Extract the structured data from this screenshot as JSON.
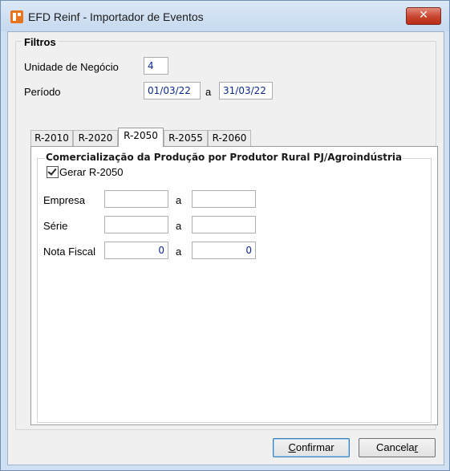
{
  "window": {
    "title": "EFD Reinf - Importador de Eventos",
    "close_label": "✕",
    "app_icon": "reinf-app-icon"
  },
  "filtros": {
    "legend": "Filtros",
    "unidade_label": "Unidade de Negócio",
    "unidade_value": "4",
    "periodo_label": "Período",
    "periodo_start": "01/03/22",
    "periodo_sep": "a",
    "periodo_end": "31/03/22"
  },
  "tabs": [
    {
      "label": "R-2010",
      "active": false
    },
    {
      "label": "R-2020",
      "active": false
    },
    {
      "label": "R-2050",
      "active": true
    },
    {
      "label": "R-2055",
      "active": false
    },
    {
      "label": "R-2060",
      "active": false
    }
  ],
  "panel": {
    "legend": "Comercialização da Produção por Produtor Rural PJ/Agroindústria",
    "gerar_label": "Gerar R-2050",
    "gerar_checked": true,
    "rows": [
      {
        "label": "Empresa",
        "from": "",
        "sep": "a",
        "to": ""
      },
      {
        "label": "Série",
        "from": "",
        "sep": "a",
        "to": ""
      },
      {
        "label": "Nota Fiscal",
        "from": "0",
        "sep": "a",
        "to": "0"
      }
    ]
  },
  "buttons": {
    "confirmar_pre": "",
    "confirmar_ul": "C",
    "confirmar_post": "onfirmar",
    "cancelar_pre": "Cancela",
    "cancelar_ul": "r",
    "cancelar_post": ""
  }
}
